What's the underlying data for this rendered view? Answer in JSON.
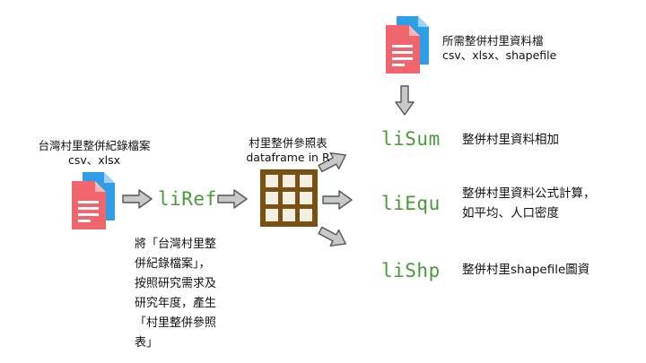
{
  "source_file": {
    "title": "台灣村里整併紀錄檔案",
    "formats": "csv、xlsx"
  },
  "required_file": {
    "title": "所需整併村里資料檔",
    "formats": "csv、xlsx、shapefile"
  },
  "reference_table": {
    "title": "村里整併參照表",
    "subtitle": "dataframe in R"
  },
  "functions": [
    {
      "name": "liRef",
      "description": ""
    },
    {
      "name": "liSum",
      "description": "整併村里資料相加"
    },
    {
      "name": "liEqu",
      "description": "整併村里資料公式計算，如平均、人口密度",
      "line1": "整併村里資料公式計算，",
      "line2": "如平均、人口密度"
    },
    {
      "name": "liShp",
      "description": "整併村里shapefile圖資"
    }
  ],
  "liref_note": {
    "lines": [
      "將「台灣村里整",
      "併紀錄檔案」，",
      "按照研究需求及",
      "研究年度，產生",
      "「村里整併參照",
      "表」"
    ]
  },
  "colors": {
    "function_text": "#4a9a3a",
    "arrow_fill": "#c8c8c8",
    "arrow_stroke": "#555555",
    "doc_front": "#f0666c",
    "doc_back": "#2e9fe6",
    "table_frame": "#7a4f12",
    "table_cell": "#f3efe2"
  }
}
